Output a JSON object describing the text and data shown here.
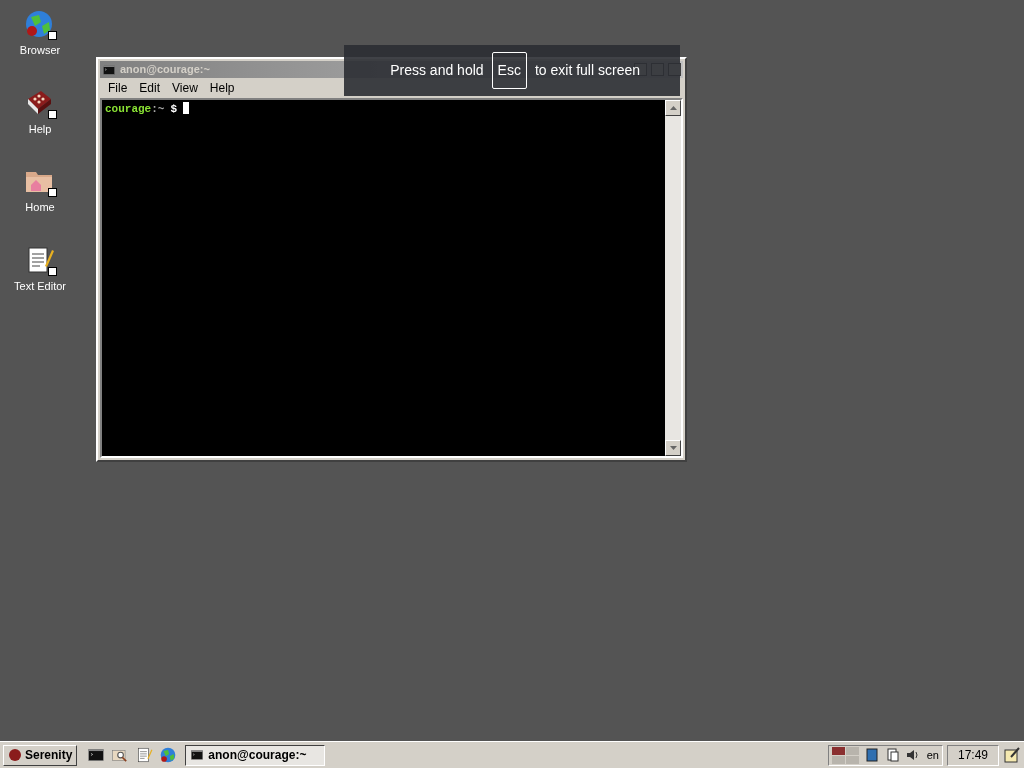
{
  "desktop_icons": [
    {
      "kind": "globe",
      "label": "Browser"
    },
    {
      "kind": "book",
      "label": "Help"
    },
    {
      "kind": "folder",
      "label": "Home"
    },
    {
      "kind": "notepad",
      "label": "Text Editor"
    }
  ],
  "window": {
    "title": "anon@courage:~",
    "menu": [
      "File",
      "Edit",
      "View",
      "Help"
    ],
    "prompt_host": "courage",
    "prompt_path": ":~",
    "prompt_sign": "$"
  },
  "fullscreen_notice": {
    "before": "Press and hold",
    "key": "Esc",
    "after": "to exit full screen"
  },
  "taskbar": {
    "start": "Serenity",
    "quick_launch": [
      {
        "kind": "terminal"
      },
      {
        "kind": "files"
      },
      {
        "kind": "notepad"
      },
      {
        "kind": "globe"
      }
    ],
    "tasks": [
      {
        "title": "anon@courage:~",
        "selected": true
      }
    ],
    "workspaces": [
      {
        "selected": true
      },
      {
        "selected": false
      },
      {
        "selected": false
      },
      {
        "selected": false
      }
    ],
    "keymap": "en",
    "clock": "17:49"
  }
}
